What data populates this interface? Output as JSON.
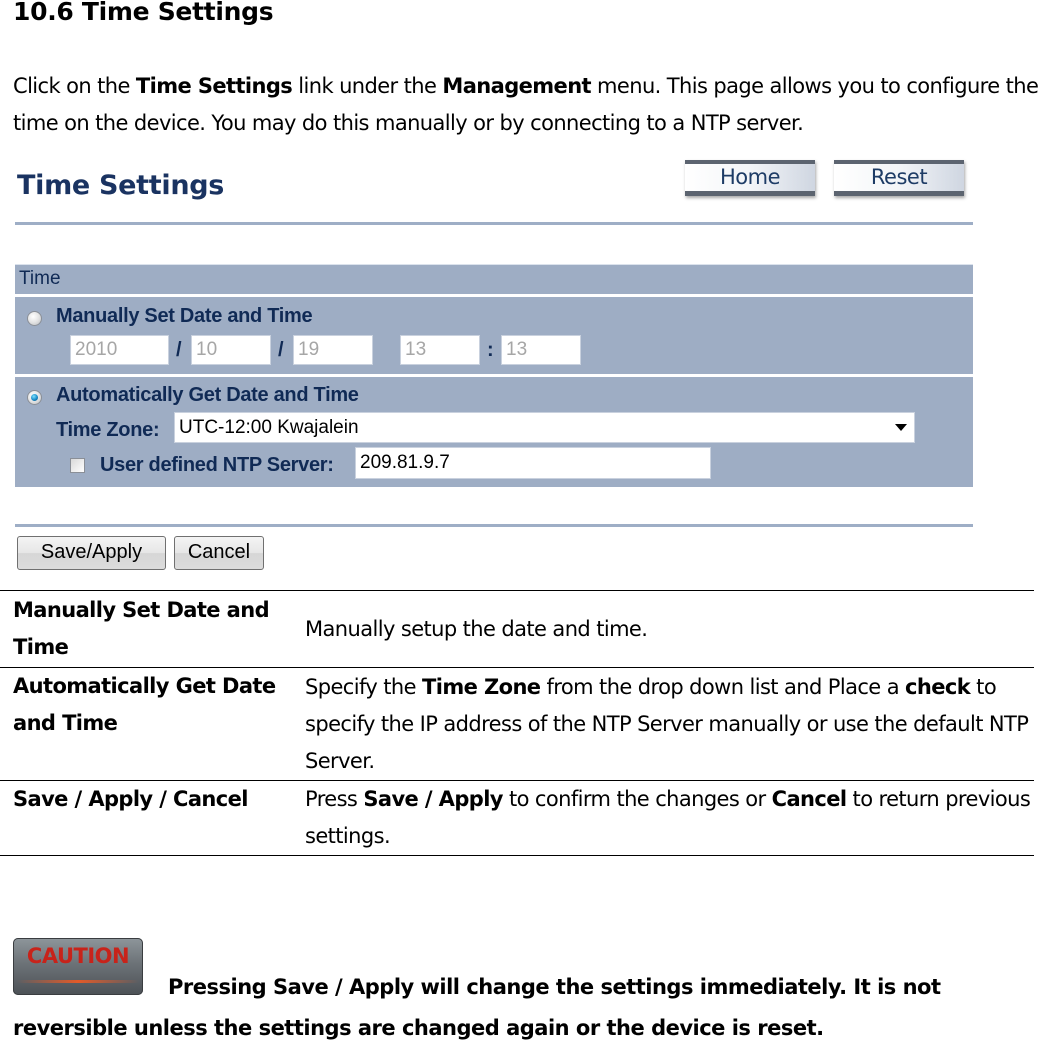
{
  "section": {
    "heading": "10.6 Time Settings",
    "intro": {
      "p1": "Click on the ",
      "b1": "Time Settings",
      "p2": " link under the ",
      "b2": "Management",
      "p3": " menu. This page allows you to configure the time on the device. You may do this manually or by connecting to a NTP server."
    }
  },
  "ui": {
    "title": "Time Settings",
    "nav": {
      "home": "Home",
      "reset": "Reset"
    },
    "panel_header": "Time",
    "manual": {
      "label": "Manually Set Date and Time",
      "selected": false,
      "year": "2010",
      "month": "10",
      "day": "19",
      "hour": "13",
      "minute": "13",
      "date_sep": "/",
      "time_sep": ":"
    },
    "auto": {
      "label": "Automatically Get Date and Time",
      "selected": true,
      "timezone_label": "Time Zone:",
      "timezone_value": "UTC-12:00 Kwajalein",
      "ntp_checkbox_checked": false,
      "ntp_label": "User defined NTP Server:",
      "ntp_value": "209.81.9.7"
    },
    "buttons": {
      "save": "Save/Apply",
      "cancel": "Cancel"
    }
  },
  "table": {
    "rows": [
      {
        "term": "Manually Set Date and Time",
        "def": [
          {
            "t": "Manually setup the date and time."
          }
        ]
      },
      {
        "term": "Automatically Get Date and Time",
        "def": [
          {
            "t": "Specify the "
          },
          {
            "b": "Time Zone"
          },
          {
            "t": " from the drop down list and Place a "
          },
          {
            "b": "check"
          },
          {
            "t": " to specify the IP address of the NTP Server manually or use the default NTP Server."
          }
        ]
      },
      {
        "term": "Save / Apply / Cancel",
        "def": [
          {
            "t": "Press "
          },
          {
            "b": "Save / Apply"
          },
          {
            "t": " to confirm the changes or "
          },
          {
            "b": "Cancel"
          },
          {
            "t": " to return previous settings."
          }
        ]
      }
    ]
  },
  "caution": {
    "badge": "CAUTION",
    "text": "Pressing Save / Apply will change the settings immediately. It is not reversible unless the settings are changed again or the device is reset."
  },
  "colors": {
    "panel": "#9eadc4",
    "heading_blue": "#102a55",
    "caution_red": "#c8231a"
  }
}
